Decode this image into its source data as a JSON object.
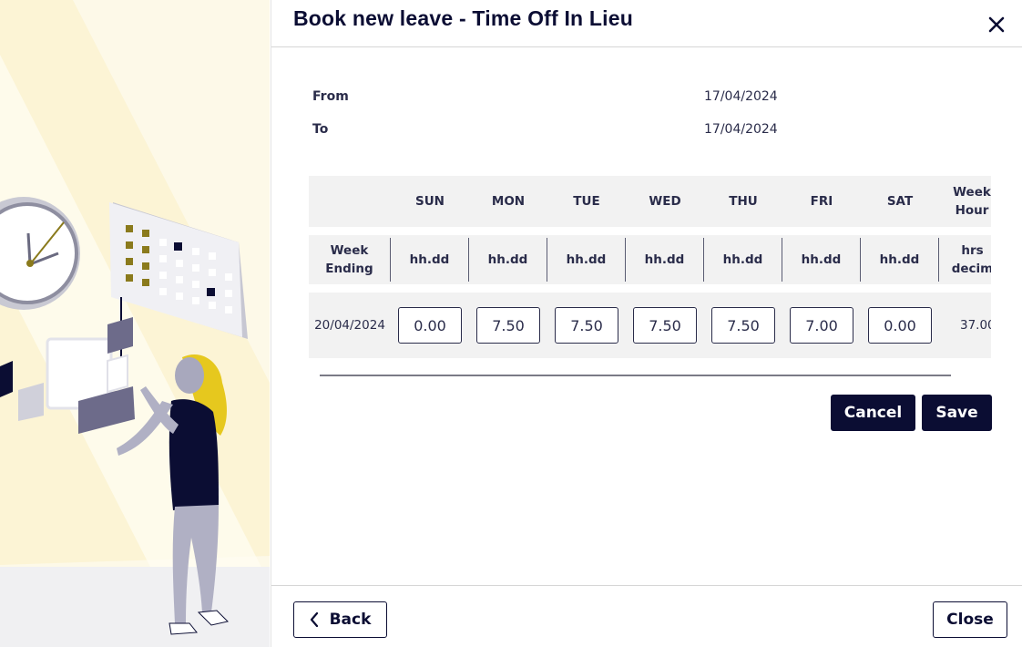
{
  "dialog": {
    "title": "Book new leave - Time Off In Lieu"
  },
  "dates": {
    "from_label": "From",
    "from_value": "17/04/2024",
    "to_label": "To",
    "to_value": "17/04/2024"
  },
  "timesheet": {
    "day_headers": [
      "SUN",
      "MON",
      "TUE",
      "WED",
      "THU",
      "FRI",
      "SAT"
    ],
    "week_hours_header_line1": "Week",
    "week_hours_header_line2": "Hour",
    "week_ending_label_line1": "Week",
    "week_ending_label_line2": "Ending",
    "unit_label": "hh.dd",
    "hours_unit_line1": "hrs",
    "hours_unit_line2": "decim",
    "rows": [
      {
        "week_ending": "20/04/2024",
        "hours": [
          "0.00",
          "7.50",
          "7.50",
          "7.50",
          "7.50",
          "7.00",
          "0.00"
        ],
        "total": "37.00"
      }
    ]
  },
  "actions": {
    "cancel_label": "Cancel",
    "save_label": "Save",
    "back_label": "Back",
    "close_label": "Close"
  },
  "icons": {
    "close": "close-icon",
    "back": "chevron-left-icon"
  },
  "colors": {
    "primary": "#0b0d33",
    "grid_background": "#f2f2f2",
    "illustration_background": "#fdf9e8",
    "accent_yellow": "#e6c81e"
  }
}
